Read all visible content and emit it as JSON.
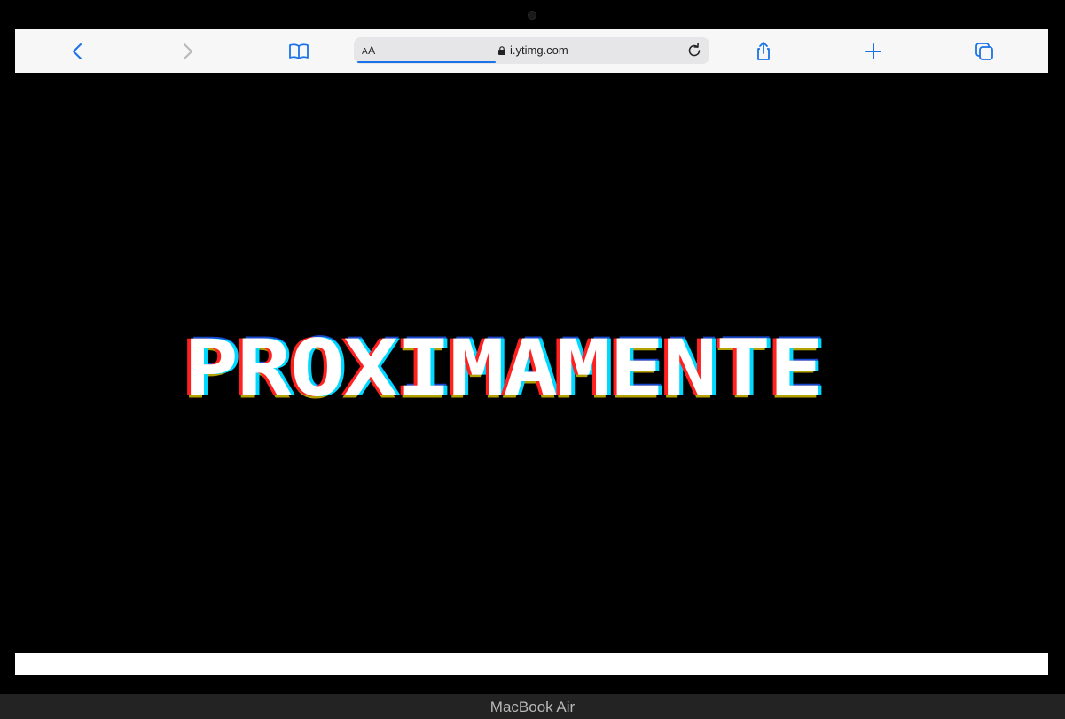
{
  "browser": {
    "reader_label_big": "A",
    "reader_label_small": "A",
    "url": "i.ytimg.com"
  },
  "page": {
    "headline": "PROXIMAMENTE"
  },
  "device": {
    "model": "MacBook Air"
  },
  "colors": {
    "accent": "#1a73e8",
    "toolbar_bg": "#f7f7f7",
    "content_bg": "#000000"
  },
  "icons": [
    "back-icon",
    "forward-icon",
    "bookmarks-icon",
    "lock-icon",
    "reload-icon",
    "share-icon",
    "new-tab-icon",
    "tabs-icon"
  ]
}
